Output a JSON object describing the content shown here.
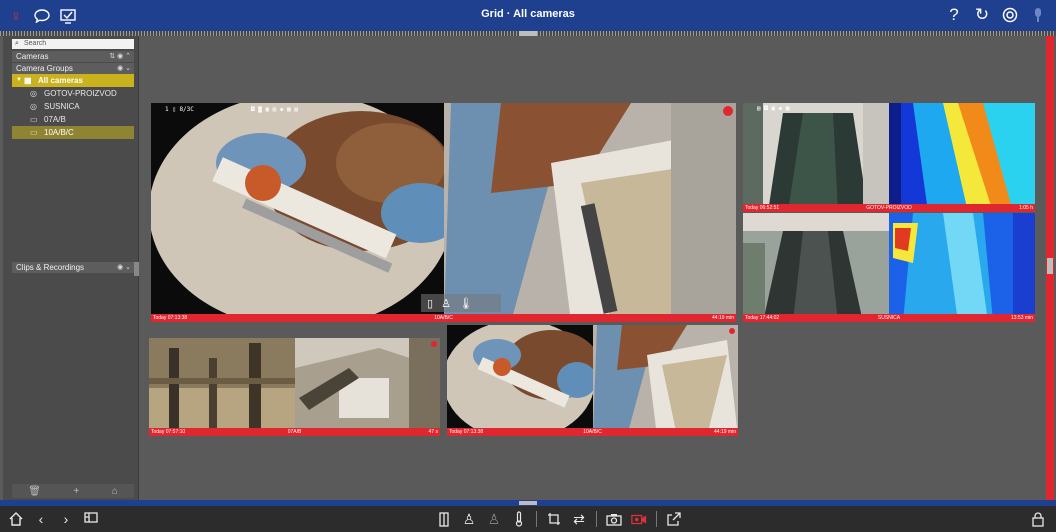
{
  "window": {
    "title": "Grid · All cameras"
  },
  "titlebar": {
    "left_icons": [
      "user-icon",
      "chat-icon",
      "monitor-check-icon"
    ],
    "right_icons": [
      "help-icon",
      "refresh-icon",
      "settings-icon",
      "pin-icon"
    ],
    "glyphs": {
      "user": "♀",
      "chat": "◯",
      "monitor": "☑",
      "help": "?",
      "refresh": "↻",
      "settings": "⚙",
      "pin": "❢"
    }
  },
  "sidebar": {
    "search_placeholder": "Search",
    "sections": {
      "cameras": "Cameras",
      "camera_groups": "Camera Groups",
      "clips": "Clips & Recordings"
    },
    "tree": {
      "root": "All cameras",
      "items": [
        "GOTOV-PROIZVOD",
        "SUSNICA",
        "07A/B",
        "10A/B/C"
      ],
      "selected": "10A/B/C"
    }
  },
  "views": {
    "main": {
      "timestamp": "Today 07:13:38",
      "name": "10A/B/C",
      "duration": "44:19 min",
      "overlay": "1 ▯ 8/3C"
    },
    "gotov": {
      "timestamp": "Today 06:52:51",
      "name": "GOTOV-PROIZVOD",
      "duration": "1:05 h"
    },
    "susnica": {
      "timestamp": "Today 17:44:02",
      "name": "SUSNICA",
      "duration": "13:53 min"
    },
    "cam07": {
      "timestamp": "Today 07:57:10",
      "name": "07A/B",
      "duration": "47 s"
    },
    "cam10b": {
      "timestamp": "Today 07:13:38",
      "name": "10A/B/C",
      "duration": "44:19 min"
    }
  },
  "colors": {
    "titlebar": "#1f3f8f",
    "accent_red": "#e0262f",
    "selected_yellow": "#c9b21d",
    "selected_olive": "#8f8431"
  },
  "toolbar": {
    "left": [
      "home-icon",
      "back-icon",
      "forward-icon",
      "layout-icon"
    ],
    "center": [
      "door-icon",
      "person-icon",
      "person-dim-icon",
      "thermometer-icon",
      "crop-icon",
      "swap-icon",
      "camera-icon",
      "record-icon",
      "export-icon"
    ],
    "right": [
      "lock-icon"
    ]
  }
}
